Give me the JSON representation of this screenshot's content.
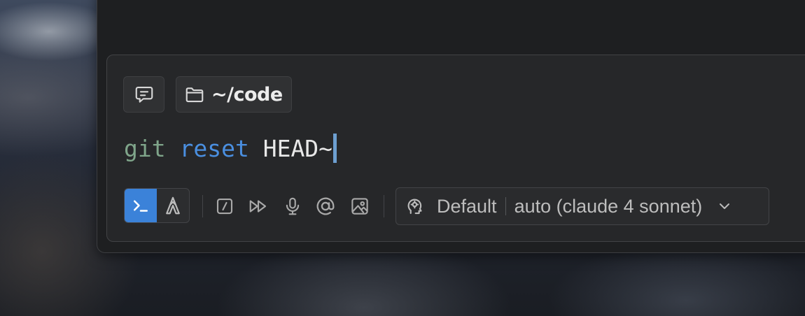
{
  "colors": {
    "window_bg": "#1e1f21",
    "composer_bg": "#262729",
    "accent": "#3b82d9",
    "cmd_token": "#7fa58a",
    "subcommand_token": "#4a8fe0",
    "arg_token": "#e8e8e8",
    "caret": "#6d9fd0"
  },
  "context": {
    "chat_icon": "chat-bubble-icon",
    "directory_icon": "folder-icon",
    "directory": "~/code"
  },
  "input": {
    "command": "git",
    "subcommand": "reset",
    "argument": "HEAD~"
  },
  "toolbar": {
    "modes": [
      {
        "icon": "terminal-icon",
        "active": true
      },
      {
        "icon": "agent-icon",
        "active": false
      }
    ],
    "tools": [
      "slash-command-icon",
      "fast-forward-icon",
      "microphone-icon",
      "at-mention-icon",
      "image-icon"
    ],
    "model_selector": {
      "icon": "profile-icon",
      "profile": "Default",
      "model": "auto (claude 4 sonnet)",
      "chevron": "chevron-down-icon"
    }
  }
}
